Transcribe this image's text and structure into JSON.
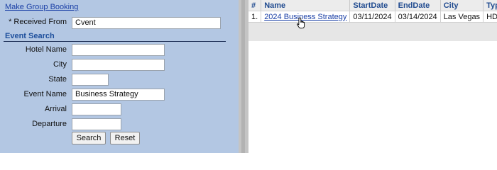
{
  "left_panel": {
    "make_group_booking": "Make Group Booking",
    "received_from": {
      "label": "* Received From",
      "value": "Cvent"
    },
    "event_search": {
      "title": "Event Search",
      "hotel_name": {
        "label": "Hotel Name",
        "value": ""
      },
      "city": {
        "label": "City",
        "value": ""
      },
      "state": {
        "label": "State",
        "value": ""
      },
      "event_name": {
        "label": "Event Name",
        "value": "Business Strategy"
      },
      "arrival": {
        "label": "Arrival",
        "value": ""
      },
      "departure": {
        "label": "Departure",
        "value": ""
      }
    },
    "buttons": {
      "search": "Search",
      "reset": "Reset"
    }
  },
  "results": {
    "columns": [
      "#",
      "Name",
      "StartDate",
      "EndDate",
      "City",
      "Type"
    ],
    "rows": [
      {
        "num": "1.",
        "name": "2024 Business Strategy",
        "start": "03/11/2024",
        "end": "03/14/2024",
        "city": "Las Vegas",
        "type": "HD"
      }
    ]
  },
  "colors": {
    "panel_bg": "#b3c7e3",
    "link": "#1a3fa6",
    "header_text": "#1f4a8f"
  }
}
